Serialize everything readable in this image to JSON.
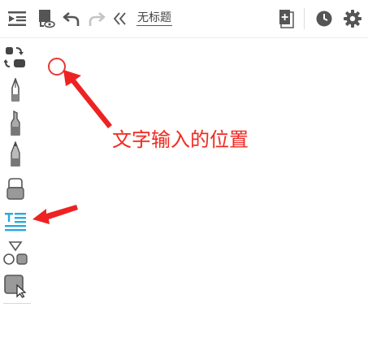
{
  "header": {
    "title": "无标题"
  },
  "annotation": {
    "text": "文字输入的位置"
  },
  "colors": {
    "toolbar_icon": "#555555",
    "active_tool": "#29a9e0",
    "annotation": "#ef2b2b"
  },
  "toolbar": {
    "left_icons": [
      "menu-collapse-icon",
      "document-view-icon",
      "undo-icon",
      "redo-icon",
      "double-chevron-left-icon"
    ],
    "right_icons": [
      "add-page-icon",
      "history-clock-icon",
      "settings-gear-icon"
    ]
  },
  "tools": [
    {
      "name": "shape-switch-tool",
      "active": false
    },
    {
      "name": "fountain-pen-tool",
      "active": false
    },
    {
      "name": "marker-tool",
      "active": false
    },
    {
      "name": "pencil-tool",
      "active": false
    },
    {
      "name": "eraser-tool",
      "active": false
    },
    {
      "name": "text-tool",
      "active": true
    },
    {
      "name": "shapes-tool",
      "active": false
    },
    {
      "name": "lasso-select-tool",
      "active": false
    }
  ]
}
